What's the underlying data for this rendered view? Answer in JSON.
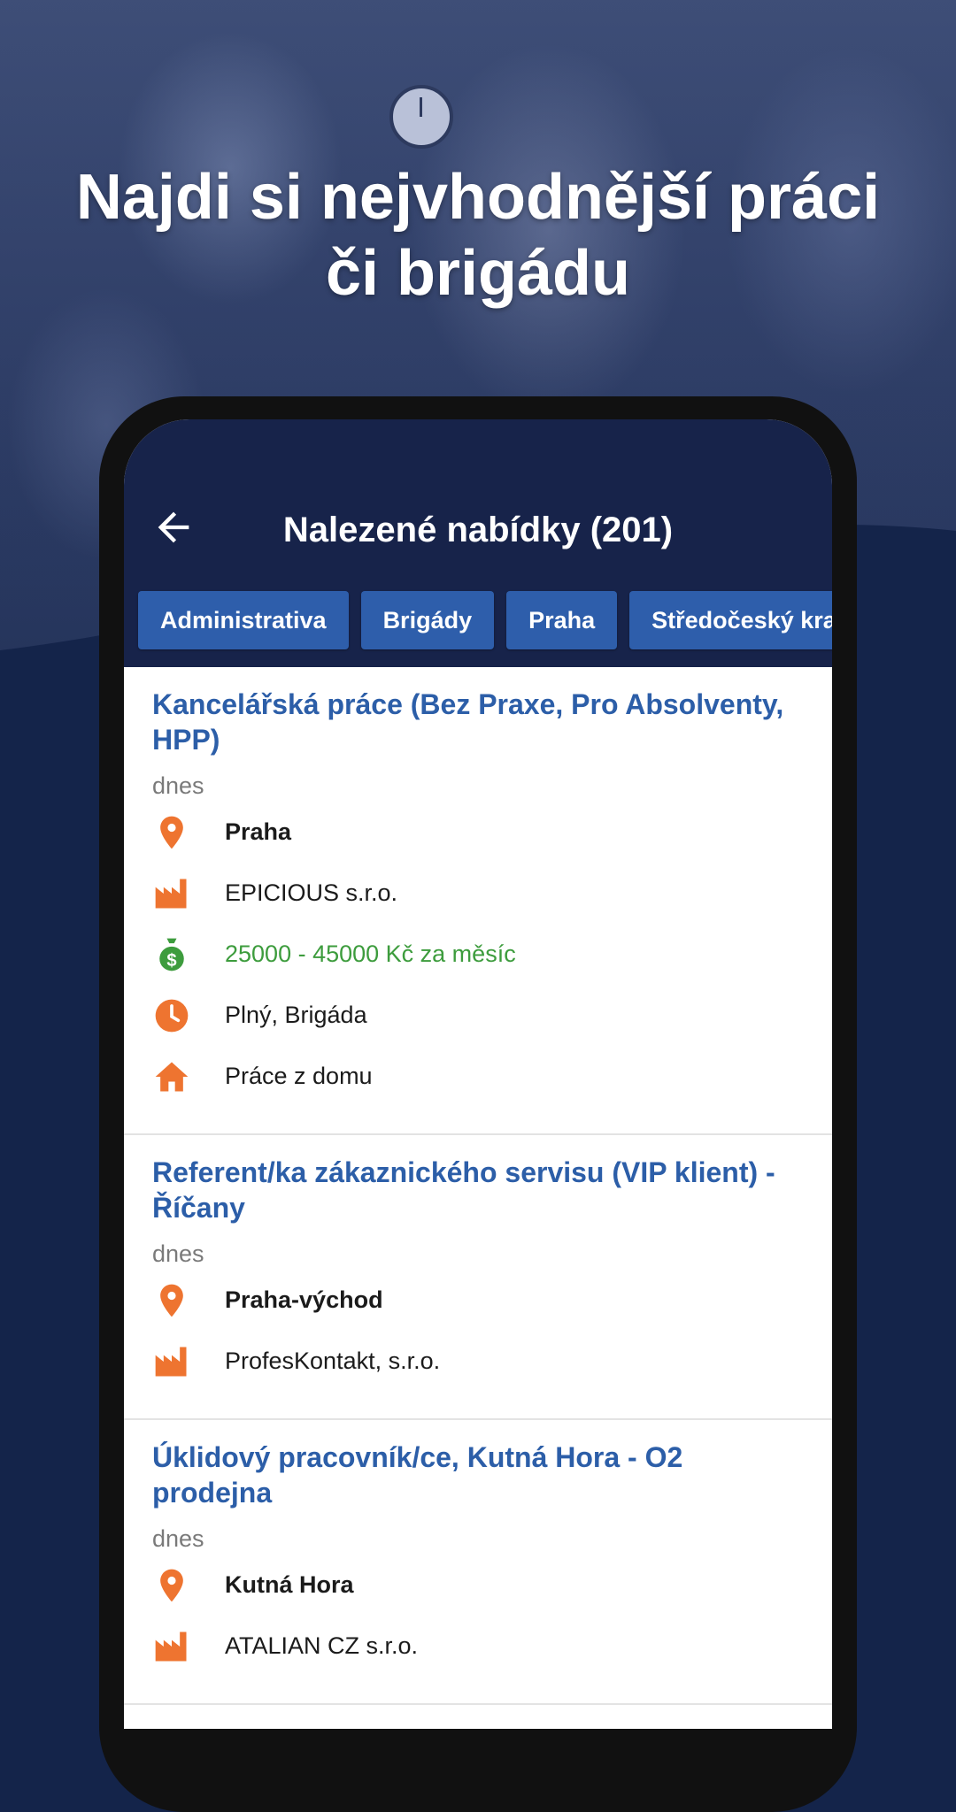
{
  "hero": {
    "headline_line1": "Najdi si nejvhodnější práci",
    "headline_line2": "či brigádu"
  },
  "appbar": {
    "title": "Nalezené nabídky (201)",
    "back_icon": "arrow-left-icon"
  },
  "filters": [
    "Administrativa",
    "Brigády",
    "Praha",
    "Středočeský kraj"
  ],
  "colors": {
    "navy": "#14244a",
    "appbar": "#17234a",
    "chip": "#2e5eab",
    "title_link": "#2c5ea8",
    "icon_orange": "#ee7430",
    "salary_green": "#3d9c3d"
  },
  "listings": [
    {
      "title": "Kancelářská práce (Bez Praxe, Pro Absolventy, HPP)",
      "date": "dnes",
      "location": "Praha",
      "company": "EPICIOUS s.r.o.",
      "salary": "25000 - 45000 Kč za měsíc",
      "schedule": "Plný, Brigáda",
      "remote": "Práce z domu"
    },
    {
      "title": "Referent/ka zákaznického servisu (VIP klient) - Říčany",
      "date": "dnes",
      "location": "Praha-východ",
      "company": "ProfesKontakt, s.r.o."
    },
    {
      "title": "Úklidový pracovník/ce, Kutná Hora - O2 prodejna",
      "date": "dnes",
      "location": "Kutná Hora",
      "company": "ATALIAN CZ s.r.o."
    }
  ]
}
